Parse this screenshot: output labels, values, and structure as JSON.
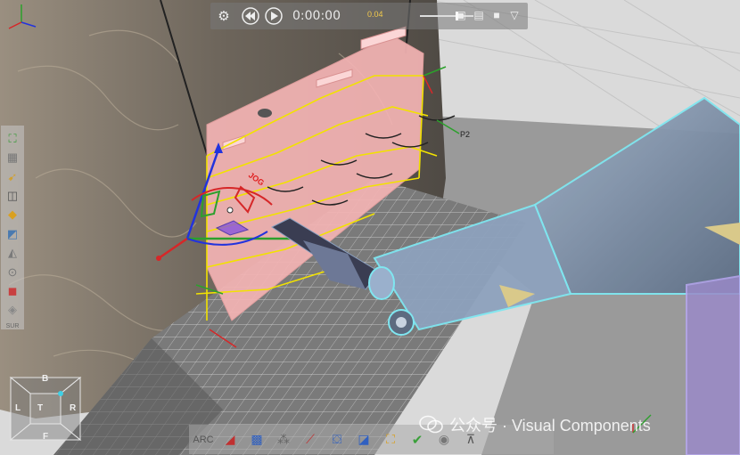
{
  "topbar": {
    "time": "0:00:00",
    "speed": "0.04"
  },
  "scene": {
    "jog_label": "JOG",
    "point_label": "P2"
  },
  "lefttoolbar": {
    "label": "SUR"
  },
  "viewcube": {
    "top": "B",
    "left": "L",
    "center_t": "T",
    "right": "R",
    "bottom": "F"
  },
  "bottombar": {
    "arc_label": "ARC"
  },
  "watermark": {
    "text": "公众号 · Visual Components"
  },
  "colors": {
    "part": "#f4b4b4",
    "yellow": "#f2e200",
    "robot": "#8c9fb8",
    "robot_outline": "#7fe6f0",
    "floor": "#6b6b6b"
  }
}
